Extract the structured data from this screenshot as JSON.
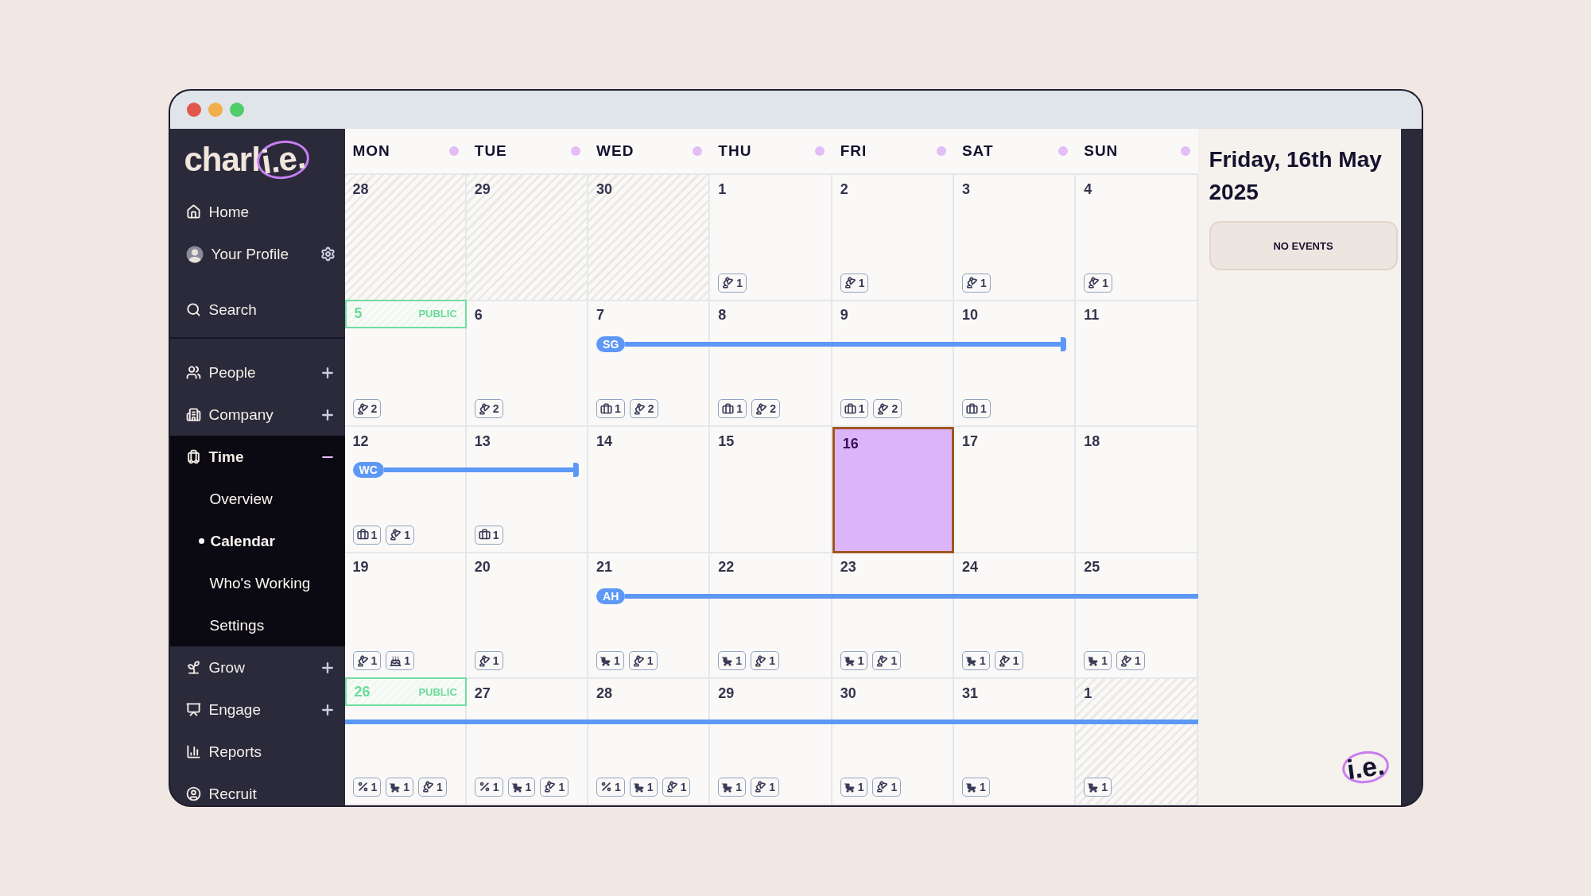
{
  "sidebar": {
    "logo": {
      "text": "charl",
      "mark": "i.e."
    },
    "items": [
      {
        "label": "Home",
        "kind": "link"
      },
      {
        "label": "Your Profile",
        "kind": "profile"
      },
      {
        "label": "Search",
        "kind": "link"
      },
      {
        "label": "People",
        "kind": "section",
        "expanded": false
      },
      {
        "label": "Company",
        "kind": "section",
        "expanded": false
      },
      {
        "label": "Time",
        "kind": "section",
        "expanded": true,
        "children": [
          {
            "label": "Overview",
            "selected": false
          },
          {
            "label": "Calendar",
            "selected": true
          },
          {
            "label": "Who's Working",
            "selected": false
          },
          {
            "label": "Settings",
            "selected": false
          }
        ]
      },
      {
        "label": "Grow",
        "kind": "section",
        "expanded": false
      },
      {
        "label": "Engage",
        "kind": "section",
        "expanded": false
      },
      {
        "label": "Reports",
        "kind": "link"
      },
      {
        "label": "Recruit",
        "kind": "link"
      }
    ]
  },
  "calendar": {
    "weekdays": [
      "MON",
      "TUE",
      "WED",
      "THU",
      "FRI",
      "SAT",
      "SUN"
    ],
    "weeks": [
      {
        "groups": [
          {
            "days": [
              {
                "number": "28",
                "outside": true,
                "selected": false
              },
              {
                "number": "29",
                "outside": true,
                "selected": false
              },
              {
                "number": "30",
                "outside": true,
                "selected": false
              },
              {
                "number": "1",
                "outside": false,
                "selected": false,
                "badges": [
                  {
                    "kind": "lamp",
                    "count": "1"
                  }
                ]
              },
              {
                "number": "2",
                "outside": false,
                "selected": false,
                "badges": [
                  {
                    "kind": "lamp",
                    "count": "1"
                  }
                ]
              },
              {
                "number": "3",
                "outside": false,
                "selected": false,
                "badges": [
                  {
                    "kind": "lamp",
                    "count": "1"
                  }
                ]
              },
              {
                "number": "4",
                "outside": false,
                "selected": false,
                "badges": [
                  {
                    "kind": "lamp",
                    "count": "1"
                  }
                ]
              }
            ]
          }
        ]
      },
      {
        "groups": [
          {
            "days": [
              {
                "number": "5",
                "outside": false,
                "selected": false,
                "holiday": "PUBLIC",
                "badges": [
                  {
                    "kind": "lamp",
                    "count": "2"
                  }
                ]
              },
              {
                "number": "6",
                "outside": false,
                "selected": false,
                "badges": [
                  {
                    "kind": "lamp",
                    "count": "2"
                  }
                ]
              }
            ]
          },
          {
            "event": {
              "label": "SG",
              "ends": true
            },
            "days": [
              {
                "number": "7",
                "outside": false,
                "selected": false,
                "badges": [
                  {
                    "kind": "suitcase",
                    "count": "1"
                  },
                  {
                    "kind": "lamp",
                    "count": "2"
                  }
                ]
              },
              {
                "number": "8",
                "outside": false,
                "selected": false,
                "badges": [
                  {
                    "kind": "suitcase",
                    "count": "1"
                  },
                  {
                    "kind": "lamp",
                    "count": "2"
                  }
                ]
              },
              {
                "number": "9",
                "outside": false,
                "selected": false,
                "badges": [
                  {
                    "kind": "suitcase",
                    "count": "1"
                  },
                  {
                    "kind": "lamp",
                    "count": "2"
                  }
                ]
              },
              {
                "number": "10",
                "outside": false,
                "selected": false,
                "badges": [
                  {
                    "kind": "suitcase",
                    "count": "1"
                  }
                ]
              }
            ]
          },
          {
            "days": [
              {
                "number": "11",
                "outside": false,
                "selected": false
              }
            ]
          }
        ]
      },
      {
        "groups": [
          {
            "event": {
              "label": "WC",
              "ends": true
            },
            "days": [
              {
                "number": "12",
                "outside": false,
                "selected": false,
                "badges": [
                  {
                    "kind": "suitcase",
                    "count": "1"
                  },
                  {
                    "kind": "lamp",
                    "count": "1"
                  }
                ]
              },
              {
                "number": "13",
                "outside": false,
                "selected": false,
                "badges": [
                  {
                    "kind": "suitcase",
                    "count": "1"
                  }
                ]
              }
            ]
          },
          {
            "days": [
              {
                "number": "14",
                "outside": false,
                "selected": false
              },
              {
                "number": "15",
                "outside": false,
                "selected": false
              },
              {
                "number": "16",
                "outside": false,
                "selected": true
              },
              {
                "number": "17",
                "outside": false,
                "selected": false
              },
              {
                "number": "18",
                "outside": false,
                "selected": false
              }
            ]
          }
        ]
      },
      {
        "groups": [
          {
            "days": [
              {
                "number": "19",
                "outside": false,
                "selected": false,
                "badges": [
                  {
                    "kind": "lamp",
                    "count": "1"
                  },
                  {
                    "kind": "cake",
                    "count": "1"
                  }
                ]
              },
              {
                "number": "20",
                "outside": false,
                "selected": false,
                "badges": [
                  {
                    "kind": "lamp",
                    "count": "1"
                  }
                ]
              }
            ]
          },
          {
            "event": {
              "label": "AH",
              "ends": false
            },
            "days": [
              {
                "number": "21",
                "outside": false,
                "selected": false,
                "badges": [
                  {
                    "kind": "pram",
                    "count": "1"
                  },
                  {
                    "kind": "lamp",
                    "count": "1"
                  }
                ]
              },
              {
                "number": "22",
                "outside": false,
                "selected": false,
                "badges": [
                  {
                    "kind": "pram",
                    "count": "1"
                  },
                  {
                    "kind": "lamp",
                    "count": "1"
                  }
                ]
              },
              {
                "number": "23",
                "outside": false,
                "selected": false,
                "badges": [
                  {
                    "kind": "pram",
                    "count": "1"
                  },
                  {
                    "kind": "lamp",
                    "count": "1"
                  }
                ]
              },
              {
                "number": "24",
                "outside": false,
                "selected": false,
                "badges": [
                  {
                    "kind": "pram",
                    "count": "1"
                  },
                  {
                    "kind": "lamp",
                    "count": "1"
                  }
                ]
              },
              {
                "number": "25",
                "outside": false,
                "selected": false,
                "badges": [
                  {
                    "kind": "pram",
                    "count": "1"
                  },
                  {
                    "kind": "lamp",
                    "count": "1"
                  }
                ]
              }
            ]
          }
        ]
      },
      {
        "groups": [
          {
            "event": {
              "ends": false
            },
            "days": [
              {
                "number": "26",
                "outside": false,
                "selected": false,
                "holiday": "PUBLIC",
                "badges": [
                  {
                    "kind": "percent",
                    "count": "1"
                  },
                  {
                    "kind": "pram",
                    "count": "1"
                  },
                  {
                    "kind": "lamp",
                    "count": "1"
                  }
                ]
              },
              {
                "number": "27",
                "outside": false,
                "selected": false,
                "badges": [
                  {
                    "kind": "percent",
                    "count": "1"
                  },
                  {
                    "kind": "pram",
                    "count": "1"
                  },
                  {
                    "kind": "lamp",
                    "count": "1"
                  }
                ]
              },
              {
                "number": "28",
                "outside": false,
                "selected": false,
                "badges": [
                  {
                    "kind": "percent",
                    "count": "1"
                  },
                  {
                    "kind": "pram",
                    "count": "1"
                  },
                  {
                    "kind": "lamp",
                    "count": "1"
                  }
                ]
              },
              {
                "number": "29",
                "outside": false,
                "selected": false,
                "badges": [
                  {
                    "kind": "pram",
                    "count": "1"
                  },
                  {
                    "kind": "lamp",
                    "count": "1"
                  }
                ]
              },
              {
                "number": "30",
                "outside": false,
                "selected": false,
                "badges": [
                  {
                    "kind": "pram",
                    "count": "1"
                  },
                  {
                    "kind": "lamp",
                    "count": "1"
                  }
                ]
              },
              {
                "number": "31",
                "outside": false,
                "selected": false,
                "badges": [
                  {
                    "kind": "pram",
                    "count": "1"
                  }
                ]
              },
              {
                "number": "1",
                "outside": true,
                "selected": false,
                "badges": [
                  {
                    "kind": "pram",
                    "count": "1"
                  }
                ]
              }
            ]
          }
        ]
      }
    ]
  },
  "details": {
    "title": "Friday, 16th May 2025",
    "empty": "NO EVENTS"
  },
  "footer_logo": "i.e."
}
